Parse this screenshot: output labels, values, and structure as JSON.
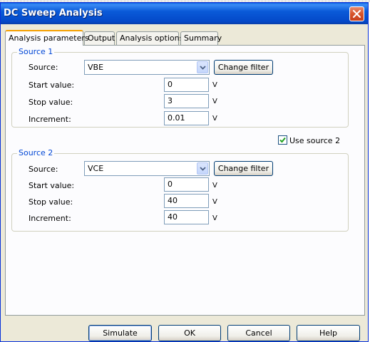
{
  "window": {
    "title": "DC Sweep Analysis",
    "close_icon": "close-icon"
  },
  "tabs": [
    {
      "label": "Analysis parameters",
      "active": true
    },
    {
      "label": "Output",
      "active": false
    },
    {
      "label": "Analysis options",
      "active": false
    },
    {
      "label": "Summary",
      "active": false
    }
  ],
  "source1": {
    "group_label": "Source 1",
    "source_label": "Source:",
    "source_value": "VBE",
    "change_filter_label": "Change filter",
    "start_label": "Start value:",
    "start_value": "0",
    "start_unit": "V",
    "stop_label": "Stop value:",
    "stop_value": "3",
    "stop_unit": "V",
    "increment_label": "Increment:",
    "increment_value": "0.01",
    "increment_unit": "V"
  },
  "use_source2": {
    "label": "Use source 2",
    "checked": true
  },
  "source2": {
    "group_label": "Source 2",
    "source_label": "Source:",
    "source_value": "VCE",
    "change_filter_label": "Change filter",
    "start_label": "Start value:",
    "start_value": "0",
    "start_unit": "V",
    "stop_label": "Stop value:",
    "stop_value": "40",
    "stop_unit": "V",
    "increment_label": "Increment:",
    "increment_value": "40",
    "increment_unit": "V"
  },
  "footer": {
    "simulate_label": "Simulate",
    "ok_label": "OK",
    "cancel_label": "Cancel",
    "help_label": "Help"
  },
  "colors": {
    "title_bar": "#0a5ad8",
    "group_legend": "#0046d5",
    "active_tab_accent": "#f6a000",
    "close_button": "#d7532a"
  }
}
